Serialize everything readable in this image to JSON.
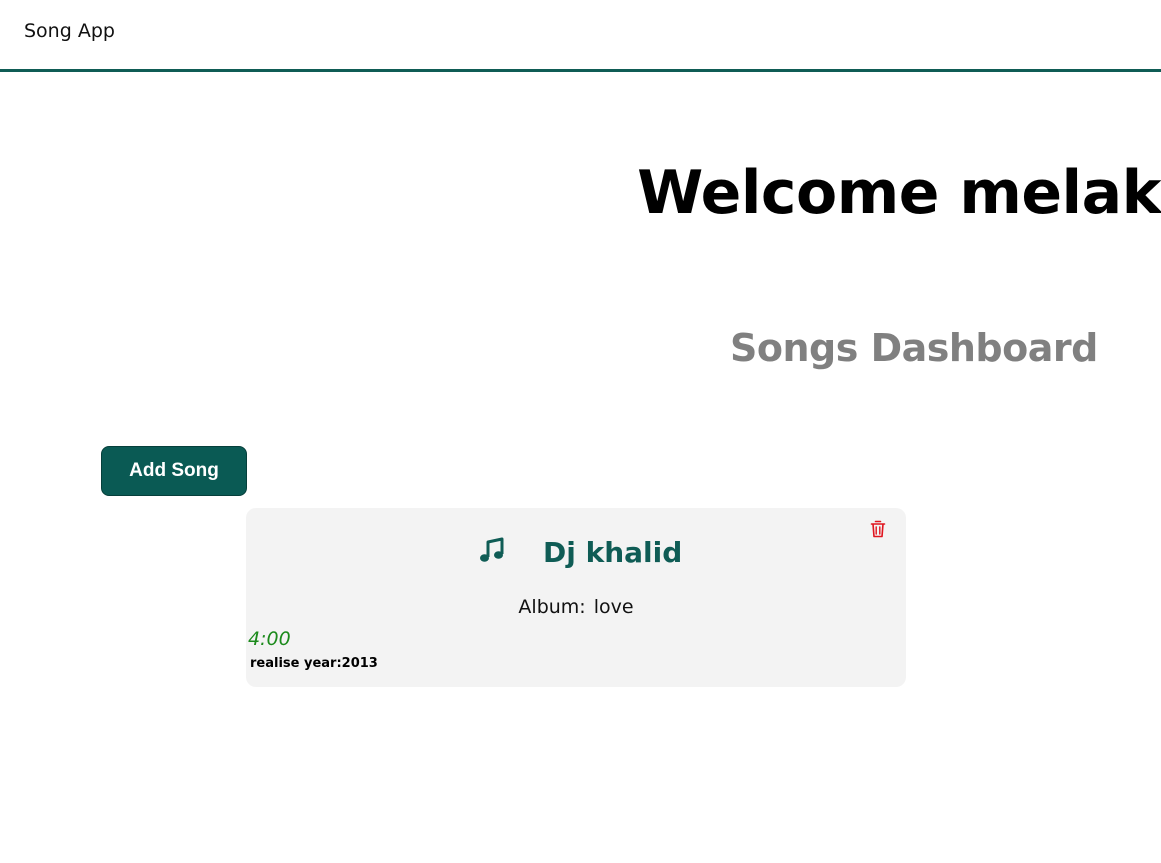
{
  "navbar": {
    "brand": "Song App"
  },
  "main": {
    "welcome": "Welcome melak",
    "dashboard_title": "Songs Dashboard",
    "add_button_label": "Add Song"
  },
  "songs": [
    {
      "artist": "Dj khalid",
      "album_label": "Album:",
      "album": "love",
      "duration": "4:00",
      "release_label": "realise year:",
      "release_year": "2013",
      "icon": "music-note-icon"
    }
  ],
  "colors": {
    "accent": "#0f5c55",
    "button_bg": "#0a5a54",
    "card_bg": "#f3f3f3",
    "heading_gray": "#808080",
    "duration_green": "#1b8a1b",
    "delete_red": "#e0141e"
  }
}
